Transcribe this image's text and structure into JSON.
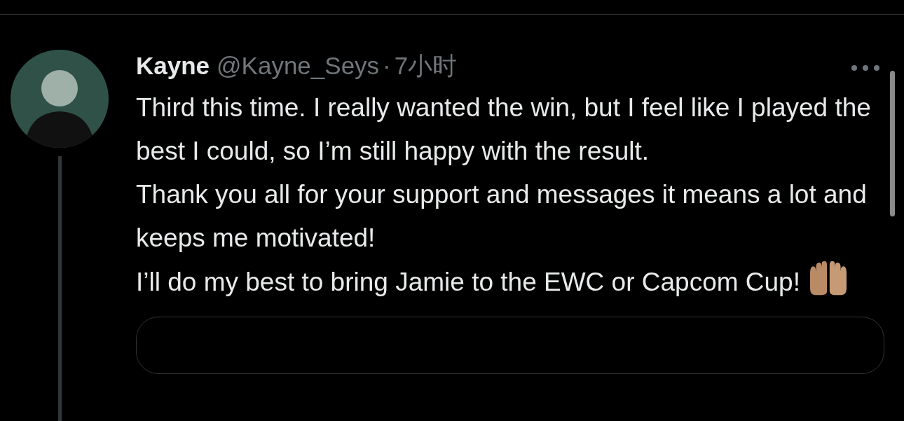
{
  "tweet": {
    "author": {
      "name": "Kayne",
      "handle": "@Kayne_Seys",
      "separator": "·",
      "time": "7小时"
    },
    "paragraphs": [
      "Third this time. I really wanted the win, but I feel like I played the best I could, so I’m still happy with the result.",
      "Thank you all for your support and messages it means a lot and keeps me motivated!",
      "I’ll do my best to bring Jamie to the EWC or Capcom Cup!"
    ]
  }
}
